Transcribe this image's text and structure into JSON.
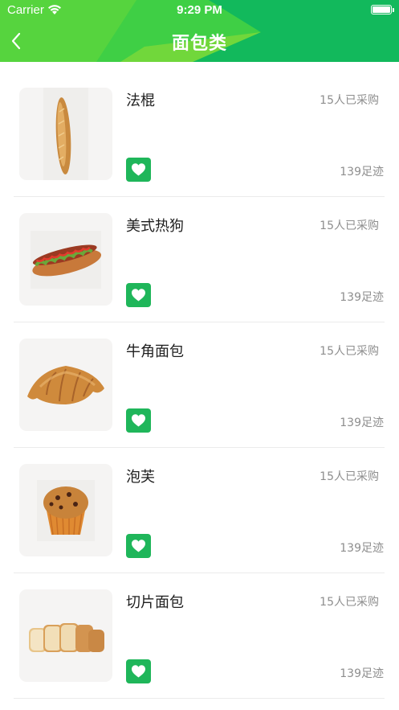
{
  "status_bar": {
    "carrier": "Carrier",
    "time": "9:29 PM"
  },
  "nav": {
    "title": "面包类"
  },
  "colors": {
    "header": "#1fc25a",
    "favorite": "#1fb65a",
    "muted_text": "#8e8e8e"
  },
  "items": [
    {
      "name": "法棍",
      "buyers": "15人已采购",
      "views": "139足迹",
      "image": "baguette"
    },
    {
      "name": "美式热狗",
      "buyers": "15人已采购",
      "views": "139足迹",
      "image": "hotdog"
    },
    {
      "name": "牛角面包",
      "buyers": "15人已采购",
      "views": "139足迹",
      "image": "croissant"
    },
    {
      "name": "泡芙",
      "buyers": "15人已采购",
      "views": "139足迹",
      "image": "muffin"
    },
    {
      "name": "切片面包",
      "buyers": "15人已采购",
      "views": "139足迹",
      "image": "sliced-bread"
    }
  ]
}
